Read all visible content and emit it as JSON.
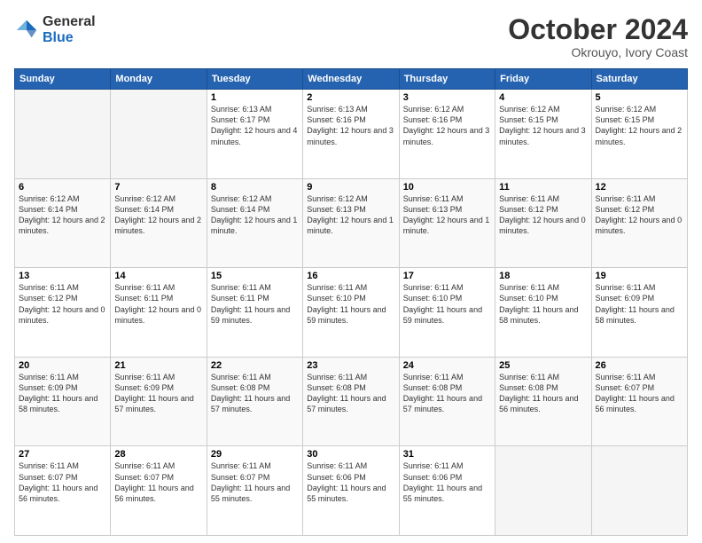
{
  "logo": {
    "general": "General",
    "blue": "Blue"
  },
  "header": {
    "month": "October 2024",
    "location": "Okrouyo, Ivory Coast"
  },
  "weekdays": [
    "Sunday",
    "Monday",
    "Tuesday",
    "Wednesday",
    "Thursday",
    "Friday",
    "Saturday"
  ],
  "weeks": [
    [
      {
        "day": "",
        "info": ""
      },
      {
        "day": "",
        "info": ""
      },
      {
        "day": "1",
        "info": "Sunrise: 6:13 AM\nSunset: 6:17 PM\nDaylight: 12 hours and 4 minutes."
      },
      {
        "day": "2",
        "info": "Sunrise: 6:13 AM\nSunset: 6:16 PM\nDaylight: 12 hours and 3 minutes."
      },
      {
        "day": "3",
        "info": "Sunrise: 6:12 AM\nSunset: 6:16 PM\nDaylight: 12 hours and 3 minutes."
      },
      {
        "day": "4",
        "info": "Sunrise: 6:12 AM\nSunset: 6:15 PM\nDaylight: 12 hours and 3 minutes."
      },
      {
        "day": "5",
        "info": "Sunrise: 6:12 AM\nSunset: 6:15 PM\nDaylight: 12 hours and 2 minutes."
      }
    ],
    [
      {
        "day": "6",
        "info": "Sunrise: 6:12 AM\nSunset: 6:14 PM\nDaylight: 12 hours and 2 minutes."
      },
      {
        "day": "7",
        "info": "Sunrise: 6:12 AM\nSunset: 6:14 PM\nDaylight: 12 hours and 2 minutes."
      },
      {
        "day": "8",
        "info": "Sunrise: 6:12 AM\nSunset: 6:14 PM\nDaylight: 12 hours and 1 minute."
      },
      {
        "day": "9",
        "info": "Sunrise: 6:12 AM\nSunset: 6:13 PM\nDaylight: 12 hours and 1 minute."
      },
      {
        "day": "10",
        "info": "Sunrise: 6:11 AM\nSunset: 6:13 PM\nDaylight: 12 hours and 1 minute."
      },
      {
        "day": "11",
        "info": "Sunrise: 6:11 AM\nSunset: 6:12 PM\nDaylight: 12 hours and 0 minutes."
      },
      {
        "day": "12",
        "info": "Sunrise: 6:11 AM\nSunset: 6:12 PM\nDaylight: 12 hours and 0 minutes."
      }
    ],
    [
      {
        "day": "13",
        "info": "Sunrise: 6:11 AM\nSunset: 6:12 PM\nDaylight: 12 hours and 0 minutes."
      },
      {
        "day": "14",
        "info": "Sunrise: 6:11 AM\nSunset: 6:11 PM\nDaylight: 12 hours and 0 minutes."
      },
      {
        "day": "15",
        "info": "Sunrise: 6:11 AM\nSunset: 6:11 PM\nDaylight: 11 hours and 59 minutes."
      },
      {
        "day": "16",
        "info": "Sunrise: 6:11 AM\nSunset: 6:10 PM\nDaylight: 11 hours and 59 minutes."
      },
      {
        "day": "17",
        "info": "Sunrise: 6:11 AM\nSunset: 6:10 PM\nDaylight: 11 hours and 59 minutes."
      },
      {
        "day": "18",
        "info": "Sunrise: 6:11 AM\nSunset: 6:10 PM\nDaylight: 11 hours and 58 minutes."
      },
      {
        "day": "19",
        "info": "Sunrise: 6:11 AM\nSunset: 6:09 PM\nDaylight: 11 hours and 58 minutes."
      }
    ],
    [
      {
        "day": "20",
        "info": "Sunrise: 6:11 AM\nSunset: 6:09 PM\nDaylight: 11 hours and 58 minutes."
      },
      {
        "day": "21",
        "info": "Sunrise: 6:11 AM\nSunset: 6:09 PM\nDaylight: 11 hours and 57 minutes."
      },
      {
        "day": "22",
        "info": "Sunrise: 6:11 AM\nSunset: 6:08 PM\nDaylight: 11 hours and 57 minutes."
      },
      {
        "day": "23",
        "info": "Sunrise: 6:11 AM\nSunset: 6:08 PM\nDaylight: 11 hours and 57 minutes."
      },
      {
        "day": "24",
        "info": "Sunrise: 6:11 AM\nSunset: 6:08 PM\nDaylight: 11 hours and 57 minutes."
      },
      {
        "day": "25",
        "info": "Sunrise: 6:11 AM\nSunset: 6:08 PM\nDaylight: 11 hours and 56 minutes."
      },
      {
        "day": "26",
        "info": "Sunrise: 6:11 AM\nSunset: 6:07 PM\nDaylight: 11 hours and 56 minutes."
      }
    ],
    [
      {
        "day": "27",
        "info": "Sunrise: 6:11 AM\nSunset: 6:07 PM\nDaylight: 11 hours and 56 minutes."
      },
      {
        "day": "28",
        "info": "Sunrise: 6:11 AM\nSunset: 6:07 PM\nDaylight: 11 hours and 56 minutes."
      },
      {
        "day": "29",
        "info": "Sunrise: 6:11 AM\nSunset: 6:07 PM\nDaylight: 11 hours and 55 minutes."
      },
      {
        "day": "30",
        "info": "Sunrise: 6:11 AM\nSunset: 6:06 PM\nDaylight: 11 hours and 55 minutes."
      },
      {
        "day": "31",
        "info": "Sunrise: 6:11 AM\nSunset: 6:06 PM\nDaylight: 11 hours and 55 minutes."
      },
      {
        "day": "",
        "info": ""
      },
      {
        "day": "",
        "info": ""
      }
    ]
  ]
}
